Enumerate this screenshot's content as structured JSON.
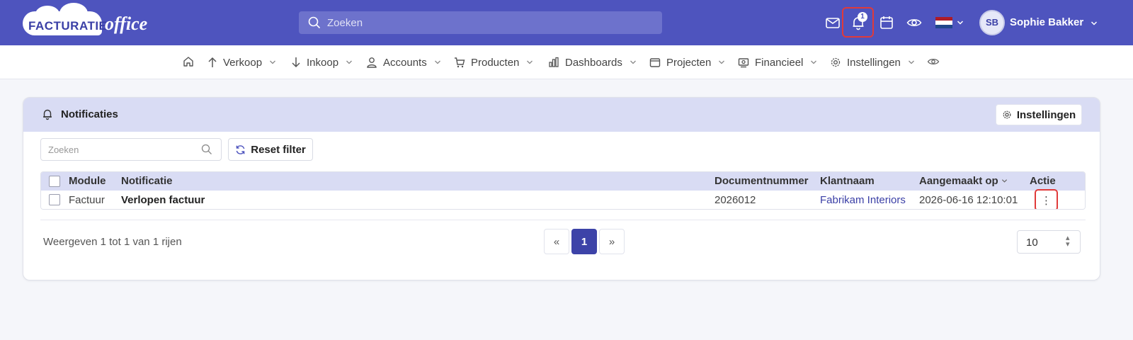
{
  "header": {
    "logo_text_1": "FACTURATIE",
    "logo_text_2": "office",
    "search_placeholder": "Zoeken",
    "notification_count": "1",
    "user_initials": "SB",
    "user_name": "Sophie Bakker",
    "accent_color": "#4e54be"
  },
  "nav": {
    "items": [
      {
        "label": "Verkoop",
        "icon": "arrow-up-icon"
      },
      {
        "label": "Inkoop",
        "icon": "arrow-down-icon"
      },
      {
        "label": "Accounts",
        "icon": "user-icon"
      },
      {
        "label": "Producten",
        "icon": "cart-icon"
      },
      {
        "label": "Dashboards",
        "icon": "bar-chart-icon"
      },
      {
        "label": "Projecten",
        "icon": "folder-icon"
      },
      {
        "label": "Financieel",
        "icon": "money-icon"
      },
      {
        "label": "Instellingen",
        "icon": "gear-icon"
      }
    ]
  },
  "card": {
    "title": "Notificaties",
    "settings_label": "Instellingen",
    "search_placeholder": "Zoeken",
    "reset_label": "Reset filter",
    "columns": [
      "Module",
      "Notificatie",
      "Documentnummer",
      "Klantnaam",
      "Aangemaakt op",
      "Actie"
    ],
    "rows": [
      {
        "module": "Factuur",
        "notificatie": "Verlopen factuur",
        "documentnummer": "2026012",
        "klantnaam": "Fabrikam Interiors",
        "aangemaakt": "2026-06-16 12:10:01",
        "actie": "⋮"
      }
    ],
    "showing_text": "Weergeven 1 tot 1 van 1 rijen",
    "pagination": {
      "prev": "«",
      "current": "1",
      "next": "»"
    },
    "page_size": "10"
  }
}
